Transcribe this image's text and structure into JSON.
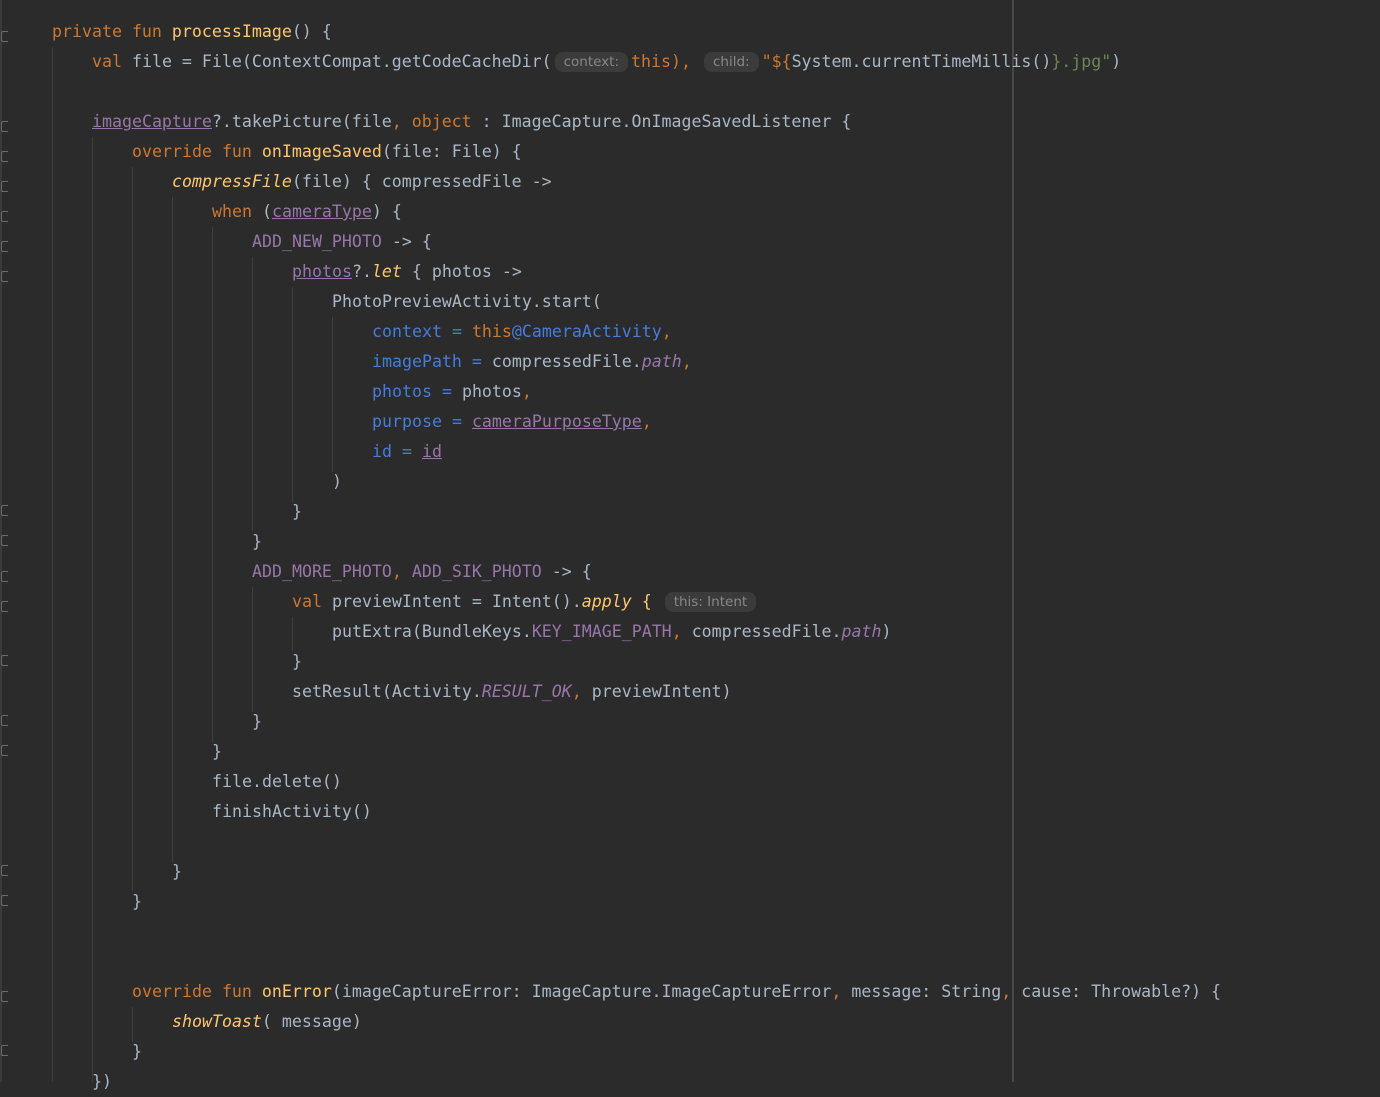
{
  "colors": {
    "background": "#2b2b2b",
    "default_text": "#a9b7c6",
    "keyword": "#cc7832",
    "function": "#ffc66d",
    "property": "#9876aa",
    "named_argument": "#467cda",
    "string": "#6a8759",
    "inlay_hint_bg": "#3b3b3b",
    "inlay_hint_text": "#878787"
  },
  "code": {
    "l1": {
      "kw_private": "private",
      "kw_fun": "fun",
      "name": "processImage",
      "rest": "() {"
    },
    "l2": {
      "kw_val": "val",
      "a": "file = File(ContextCompat.getCodeCacheDir(",
      "hint_context": "context:",
      "kw_this": "this",
      "comma": "),",
      "hint_child": "child:",
      "str_open": "\"${",
      "call": "System.currentTimeMillis()",
      "str_close": "}.jpg\"",
      "end": ")"
    },
    "l4": {
      "prop": "imageCapture",
      "a": "?.takePicture(file",
      "comma": ",",
      "kw_object": "object",
      "b": ": ImageCapture.OnImageSavedListener {"
    },
    "l5": {
      "kw_override": "override",
      "kw_fun": "fun",
      "name": "onImageSaved",
      "rest": "(file: File) {"
    },
    "l6": {
      "name": "compressFile",
      "rest": "(file) { compressedFile ->"
    },
    "l7": {
      "kw_when": "when",
      "open": "(",
      "prop": "cameraType",
      "rest": ") {"
    },
    "l8": {
      "prop": "ADD_NEW_PHOTO",
      "rest": "-> {"
    },
    "l9": {
      "prop": "photos",
      "a": "?.",
      "let": "let",
      "rest": "{ photos ->"
    },
    "l10": {
      "text": "PhotoPreviewActivity.start("
    },
    "l11": {
      "arg": "context",
      "eq": "=",
      "kw_this": "this",
      "label": "@CameraActivity",
      "comma": ","
    },
    "l12": {
      "arg": "imagePath",
      "eq": "=",
      "a": "compressedFile.",
      "prop": "path",
      "comma": ","
    },
    "l13": {
      "arg": "photos",
      "eq": "=",
      "a": "photos",
      "comma": ","
    },
    "l14": {
      "arg": "purpose",
      "eq": "=",
      "prop": "cameraPurposeType",
      "comma": ","
    },
    "l15": {
      "arg": "id",
      "eq": "=",
      "prop": "id"
    },
    "l16": {
      "text": ")"
    },
    "l17": {
      "text": "}"
    },
    "l18": {
      "text": "}"
    },
    "l19": {
      "prop1": "ADD_MORE_PHOTO",
      "comma": ",",
      "prop2": "ADD_SIK_PHOTO",
      "rest": "-> {"
    },
    "l20": {
      "kw_val": "val",
      "a": "previewIntent = Intent().",
      "apply": "apply",
      "brace": "{",
      "hint": "this: Intent"
    },
    "l21": {
      "a": "putExtra(BundleKeys.",
      "prop": "KEY_IMAGE_PATH",
      "comma": ",",
      "b": "compressedFile.",
      "prop2": "path",
      "end": ")"
    },
    "l22": {
      "text": "}"
    },
    "l23": {
      "a": "setResult(Activity.",
      "prop": "RESULT_OK",
      "comma": ",",
      "b": "previewIntent)"
    },
    "l24": {
      "text": "}"
    },
    "l25": {
      "text": "}"
    },
    "l26": {
      "text": "file.delete()"
    },
    "l27": {
      "text": "finishActivity()"
    },
    "l29": {
      "text": "}"
    },
    "l30": {
      "text": "}"
    },
    "l33": {
      "kw_override": "override",
      "kw_fun": "fun",
      "name": "onError",
      "a": "(imageCaptureError: ImageCapture.ImageCaptureError",
      "c1": ",",
      "b": "message: String",
      "c2": ",",
      "c": "cause: Throwable?) {"
    },
    "l34": {
      "name": "showToast",
      "rest": "( message)"
    },
    "l35": {
      "text": "}"
    },
    "l36": {
      "text": "})"
    }
  }
}
